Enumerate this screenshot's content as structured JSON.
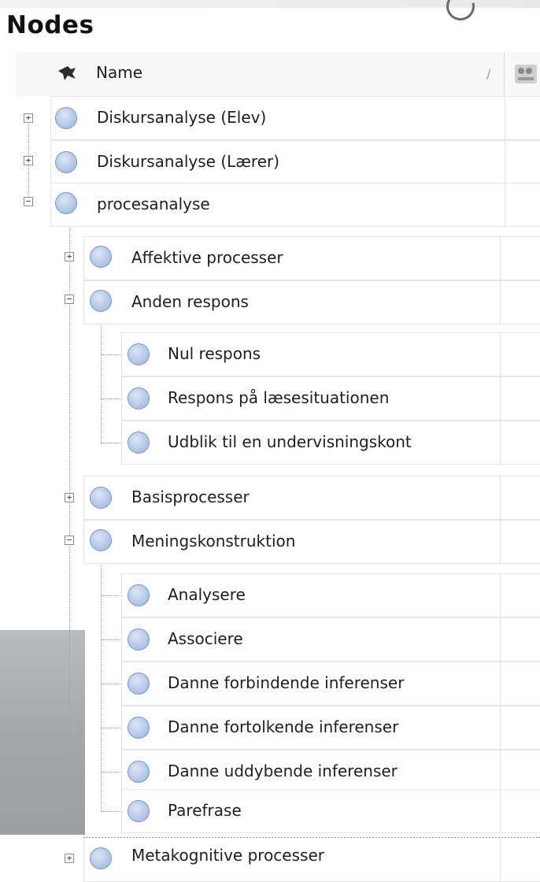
{
  "panel": {
    "title": "Nodes",
    "header": {
      "name_label": "Name",
      "sort_glyph": "/"
    },
    "icons": {
      "pin": "pin-icon",
      "column": "link-column-icon",
      "node": "node-circle-icon"
    }
  },
  "rows": {
    "diskursanalyse_elev": {
      "label": "Diskursanalyse (Elev)",
      "expander": "+"
    },
    "diskursanalyse_laerer": {
      "label": "Diskursanalyse (Lærer)",
      "expander": "+"
    },
    "procesanalyse": {
      "label": "procesanalyse",
      "expander": "−"
    },
    "affektive_processer": {
      "label": "Affektive processer",
      "expander": "+"
    },
    "anden_respons": {
      "label": "Anden respons",
      "expander": "−"
    },
    "nul_respons": {
      "label": "Nul respons"
    },
    "respons_paa": {
      "label": "Respons på læsesituationen"
    },
    "udblik": {
      "label": "Udblik til en undervisningskont"
    },
    "basisprocesser": {
      "label": "Basisprocesser",
      "expander": "+"
    },
    "meningskonstruktion": {
      "label": "Meningskonstruktion",
      "expander": "−"
    },
    "analysere": {
      "label": "Analysere"
    },
    "associere": {
      "label": "Associere"
    },
    "danne_forbindende": {
      "label": "Danne forbindende inferenser"
    },
    "danne_fortolkende": {
      "label": "Danne fortolkende inferenser"
    },
    "danne_uddybende": {
      "label": "Danne uddybende inferenser"
    },
    "parefrase": {
      "label": "Parefrase"
    },
    "metakognitive_processer": {
      "label": "Metakognitive processer",
      "expander": "+"
    }
  },
  "colors": {
    "node_fill": "#b7c9e8",
    "node_border": "#7d95c2",
    "grid": "#e6e6e6"
  }
}
